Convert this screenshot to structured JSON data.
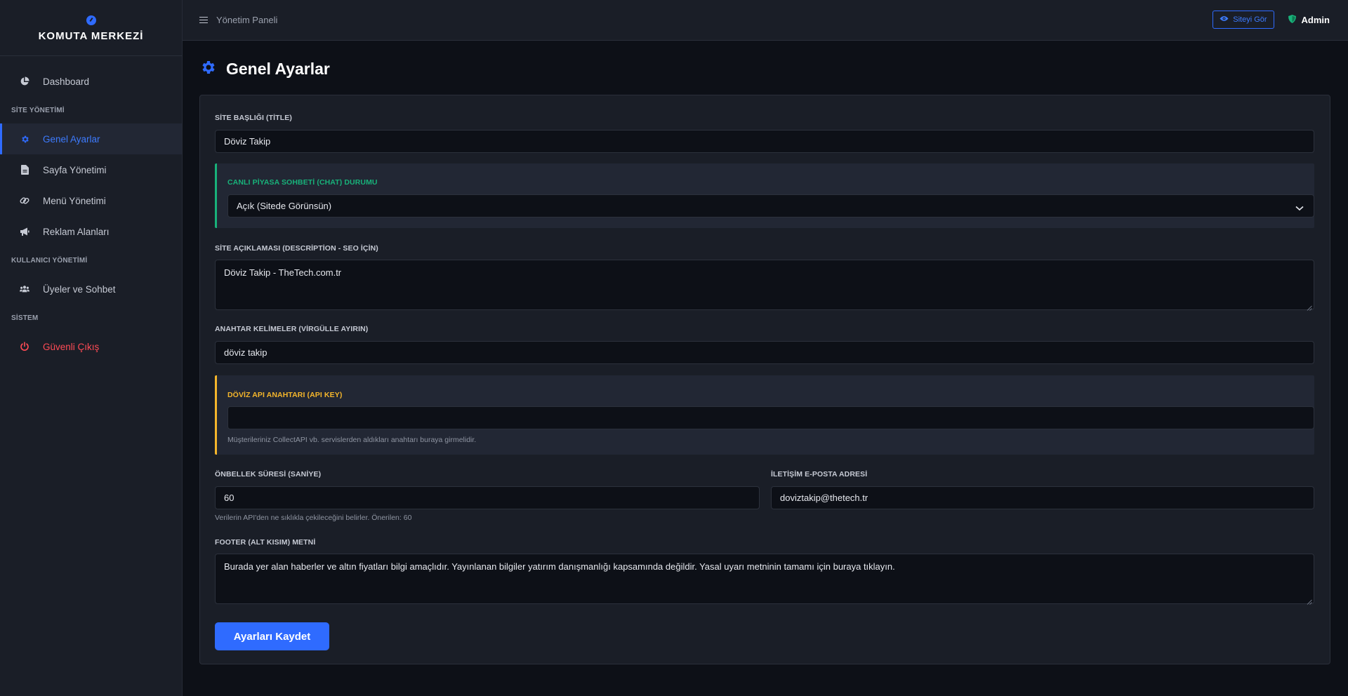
{
  "sidebar": {
    "brand": "KOMUTA MERKEZİ",
    "items": {
      "dashboard": "Dashboard",
      "section_site": "SİTE YÖNETİMİ",
      "general": "Genel Ayarlar",
      "pages": "Sayfa Yönetimi",
      "menus": "Menü Yönetimi",
      "ads": "Reklam Alanları",
      "section_users": "KULLANICI YÖNETİMİ",
      "members": "Üyeler ve Sohbet",
      "section_system": "SİSTEM",
      "logout": "Güvenli Çıkış"
    },
    "active_color": "#2f6bff",
    "danger_color": "#ff4b55"
  },
  "topbar": {
    "title": "Yönetim Paneli",
    "view_site": "Siteyi Gör",
    "user": "Admin"
  },
  "page": {
    "title": "Genel Ayarlar"
  },
  "form": {
    "site_title": {
      "label": "SİTE BAŞLIĞI (TİTLE)",
      "value": "Döviz Takip"
    },
    "chat_status": {
      "label": "CANLI PİYASA SOHBETİ (CHAT) DURUMU",
      "value": "Açık (Sitede Görünsün)"
    },
    "description": {
      "label": "SİTE AÇIKLAMASI (DESCRİPTİON - SEO İÇİN)",
      "value": "Döviz Takip - TheTech.com.tr"
    },
    "keywords": {
      "label": "ANAHTAR KELİMELER (VİRGÜLLE AYIRIN)",
      "value": "döviz takip"
    },
    "api_key": {
      "label": "DÖVİZ API ANAHTARI (API KEY)",
      "value": "",
      "help": "Müşterileriniz CollectAPI vb. servislerden aldıkları anahtarı buraya girmelidir."
    },
    "cache": {
      "label": "ÖNBELLEK SÜRESİ (SANİYE)",
      "value": "60",
      "help": "Verilerin API'den ne sıklıkla çekileceğini belirler. Önerilen: 60"
    },
    "email": {
      "label": "İLETİŞİM E-POSTA ADRESİ",
      "value": "doviztakip@thetech.tr"
    },
    "footer": {
      "label": "FOOTER (ALT KISIM) METNİ",
      "value": "Burada yer alan haberler ve altın fiyatları bilgi amaçlıdır. Yayınlanan bilgiler yatırım danışmanlığı kapsamında değildir. Yasal uyarı metninin tamamı için buraya tıklayın."
    },
    "save": "Ayarları Kaydet"
  },
  "colors": {
    "accent": "#2f6bff",
    "green": "#18b27a",
    "yellow": "#f5b62b"
  }
}
